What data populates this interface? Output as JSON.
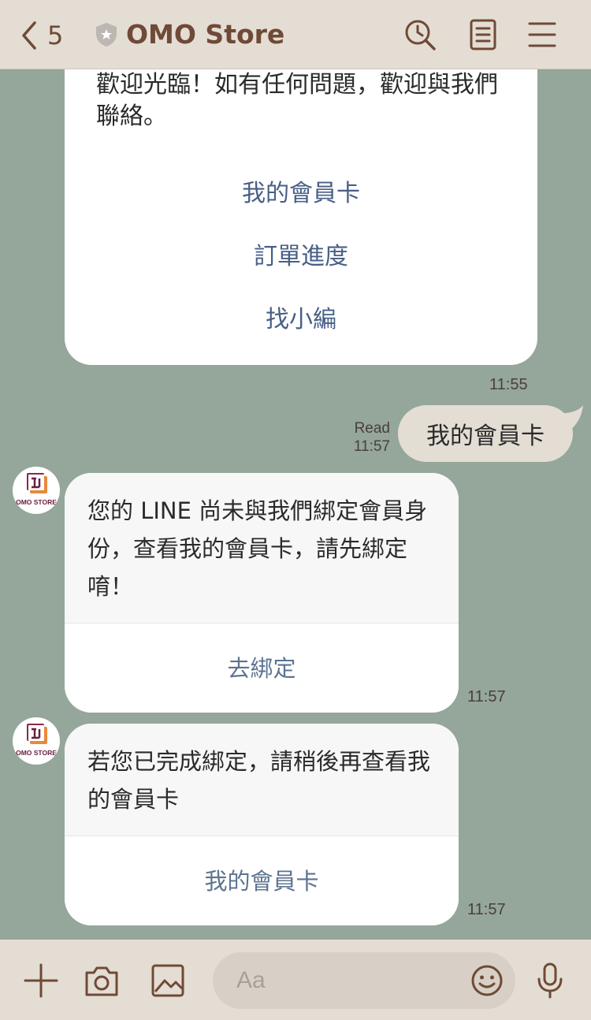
{
  "header": {
    "back_count": "5",
    "title": "OMO Store",
    "icons": [
      "search-clock-icon",
      "notes-icon",
      "menu-icon"
    ]
  },
  "messages": {
    "welcome": {
      "text": "歡迎光臨！如有任何問題，歡迎與我們聯絡。",
      "options": [
        "我的會員卡",
        "訂單進度",
        "找小編"
      ],
      "time": "11:55"
    },
    "user": {
      "text": "我的會員卡",
      "read_label": "Read",
      "time": "11:57"
    },
    "bot1": {
      "avatar_label": "OMO STORE",
      "text": "您的 LINE 尚未與我們綁定會員身份，查看我的會員卡，請先綁定唷！",
      "button": "去綁定",
      "time": "11:57"
    },
    "bot2": {
      "avatar_label": "OMO STORE",
      "text": "若您已完成綁定，請稍後再查看我的會員卡",
      "button": "我的會員卡",
      "time": "11:57"
    }
  },
  "footer": {
    "placeholder": "Aa",
    "icons": [
      "plus-icon",
      "camera-icon",
      "image-icon",
      "emoji-icon",
      "microphone-icon"
    ]
  },
  "colors": {
    "chat_background": "#95a69a",
    "header_background": "#e4ddd4",
    "brand_text": "#6f4a36",
    "link_blue": "#485f86"
  }
}
